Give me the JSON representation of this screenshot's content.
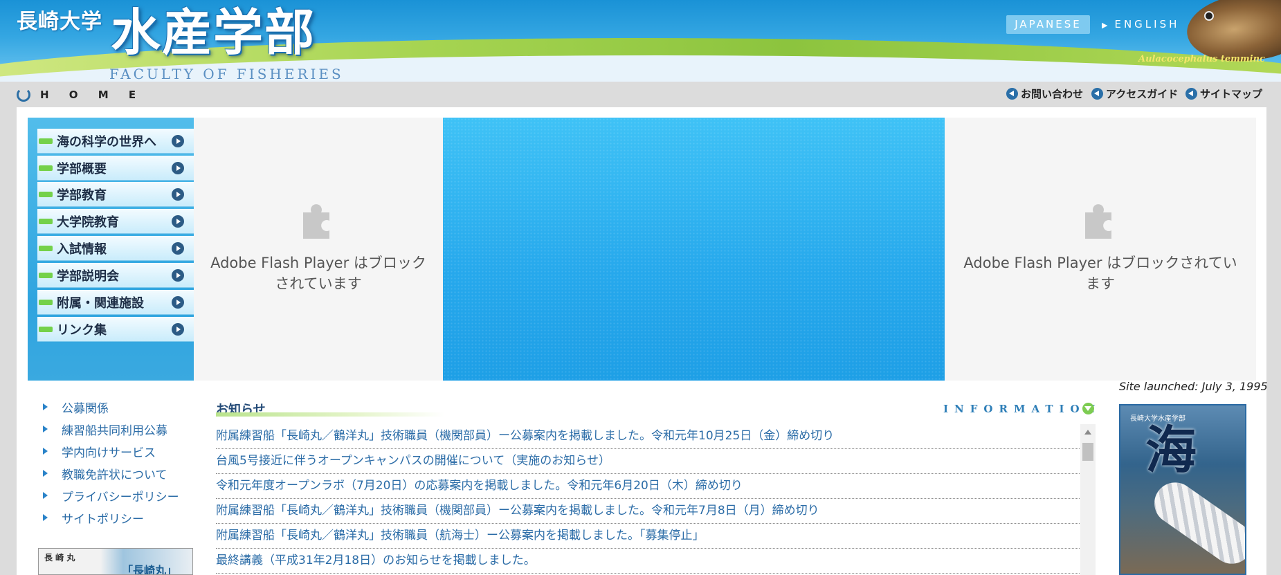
{
  "header": {
    "university": "長崎大学",
    "faculty": "水産学部",
    "faculty_en": "FACULTY OF FISHERIES",
    "fish_caption": "Aulacocephalus temminc",
    "lang_japanese": "JAPANESE",
    "lang_english": "ENGLISH"
  },
  "subnav": {
    "home": "H O M E",
    "contact": "お問い合わせ",
    "access": "アクセスガイド",
    "sitemap": "サイトマップ"
  },
  "menu": [
    {
      "label": "海の科学の世界へ"
    },
    {
      "label": "学部概要"
    },
    {
      "label": "学部教育"
    },
    {
      "label": "大学院教育"
    },
    {
      "label": "入試情報"
    },
    {
      "label": "学部説明会"
    },
    {
      "label": "附属・関連施設"
    },
    {
      "label": "リンク集"
    }
  ],
  "flash": {
    "left_message": "Adobe Flash Player はブロックされています",
    "right_message": "Adobe Flash Player はブロックされています"
  },
  "launched": "Site launched: July 3, 1995",
  "links": [
    {
      "label": "公募関係"
    },
    {
      "label": "練習船共同利用公募"
    },
    {
      "label": "学内向けサービス"
    },
    {
      "label": "教職免許状について"
    },
    {
      "label": "プライバシーポリシー"
    },
    {
      "label": "サイトポリシー"
    }
  ],
  "ship_banner": {
    "line1": "長 崎 丸",
    "line2": "「長崎丸」"
  },
  "news": {
    "heading": "お知らせ",
    "info_label": "INFORMATION",
    "items": [
      "附属練習船「長崎丸／鶴洋丸」技術職員（機関部員）ー公募案内を掲載しました。令和元年10月25日（金）締め切り",
      "台風5号接近に伴うオープンキャンパスの開催について（実施のお知らせ）",
      "令和元年度オープンラボ（7月20日）の応募案内を掲載しました。令和元年6月20日（木）締め切り",
      "附属練習船「長崎丸／鶴洋丸」技術職員（機関部員）ー公募案内を掲載しました。令和元年7月8日（月）締め切り",
      "附属練習船「長崎丸／鶴洋丸」技術職員（航海士）ー公募案内を掲載しました。「募集停止」",
      "最終講義（平成31年2月18日）のお知らせを掲載しました。"
    ]
  },
  "magazine": {
    "title": "長崎大学水産学部",
    "big": "海"
  },
  "colors": {
    "accent_blue": "#2aaef0",
    "link_blue": "#2b6ca7",
    "green": "#74d14a"
  }
}
